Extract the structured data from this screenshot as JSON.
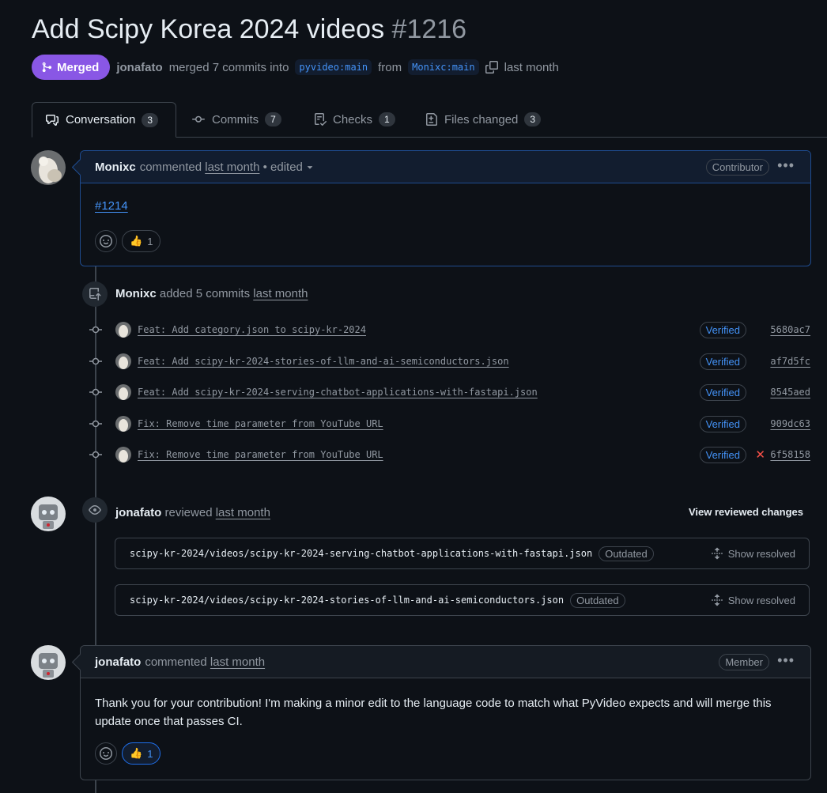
{
  "header": {
    "title": "Add Scipy Korea 2024 videos",
    "number": "#1216",
    "state": "Merged",
    "author": "jonafato",
    "action": "merged 7 commits into",
    "base_branch": "pyvideo:main",
    "from_word": "from",
    "head_branch": "Monixc:main",
    "time": "last month"
  },
  "tabs": [
    {
      "label": "Conversation",
      "count": "3",
      "icon": "comment-discussion-icon"
    },
    {
      "label": "Commits",
      "count": "7",
      "icon": "git-commit-icon"
    },
    {
      "label": "Checks",
      "count": "1",
      "icon": "checklist-icon"
    },
    {
      "label": "Files changed",
      "count": "3",
      "icon": "file-diff-icon"
    }
  ],
  "first_comment": {
    "author": "Monixc",
    "action": "commented",
    "time": "last month",
    "edited": "• edited",
    "role": "Contributor",
    "body_link": "#1214",
    "reaction_count": "1"
  },
  "commits_event": {
    "author": "Monixc",
    "action": "added 5 commits",
    "time": "last month",
    "commits": [
      {
        "message": "Feat: Add category.json to scipy-kr-2024",
        "badge": "Verified",
        "sha": "5680ac7"
      },
      {
        "message": "Feat: Add scipy-kr-2024-stories-of-llm-and-ai-semiconductors.json",
        "badge": "Verified",
        "sha": "af7d5fc"
      },
      {
        "message": "Feat: Add scipy-kr-2024-serving-chatbot-applications-with-fastapi.json",
        "badge": "Verified",
        "sha": "8545aed"
      },
      {
        "message": "Fix: Remove time parameter from YouTube URL",
        "badge": "Verified",
        "sha": "909dc63"
      },
      {
        "message": "Fix: Remove time parameter from YouTube URL",
        "badge": "Verified",
        "sha": "6f58158",
        "failed": "✕"
      }
    ]
  },
  "review_event": {
    "author": "jonafato",
    "action": "reviewed",
    "time": "last month",
    "view_changes": "View reviewed changes",
    "files": [
      {
        "path": "scipy-kr-2024/videos/scipy-kr-2024-serving-chatbot-applications-with-fastapi.json",
        "badge": "Outdated",
        "action": "Show resolved"
      },
      {
        "path": "scipy-kr-2024/videos/scipy-kr-2024-stories-of-llm-and-ai-semiconductors.json",
        "badge": "Outdated",
        "action": "Show resolved"
      }
    ]
  },
  "second_comment": {
    "author": "jonafato",
    "action": "commented",
    "time": "last month",
    "role": "Member",
    "body": "Thank you for your contribution! I'm making a minor edit to the language code to match what PyVideo expects and will merge this update once that passes CI.",
    "reaction_count": "1"
  },
  "colors": {
    "merged": "#8957e5",
    "link": "#4493f8",
    "background": "#0d1117",
    "border": "#3d444d",
    "danger": "#f85149"
  }
}
